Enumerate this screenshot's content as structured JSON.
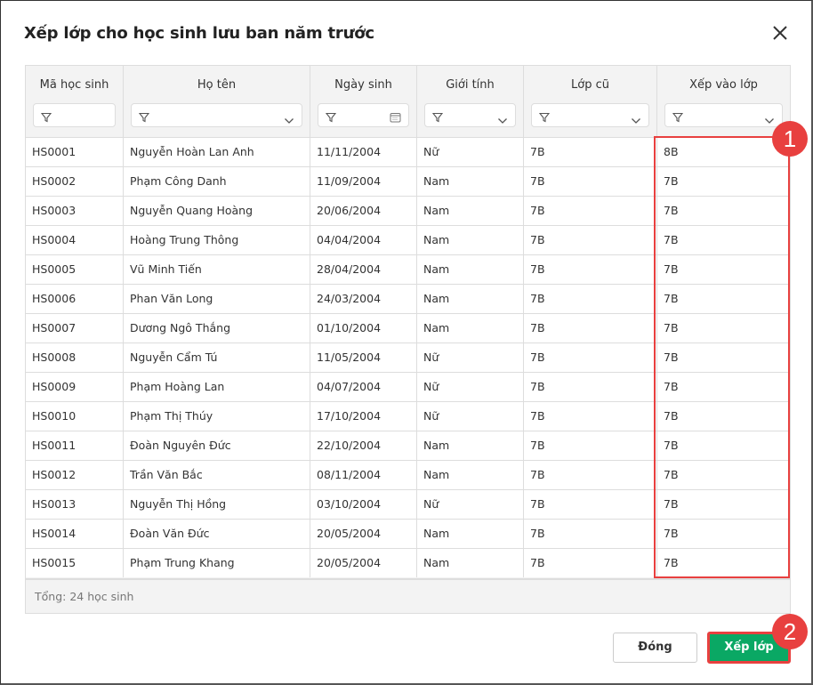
{
  "dialog": {
    "title": "Xếp lớp cho học sinh lưu ban năm trước"
  },
  "columns": [
    {
      "label": "Mã học sinh",
      "filter": "text"
    },
    {
      "label": "Họ tên",
      "filter": "dropdown"
    },
    {
      "label": "Ngày sinh",
      "filter": "date"
    },
    {
      "label": "Giới tính",
      "filter": "dropdown"
    },
    {
      "label": "Lớp cũ",
      "filter": "dropdown"
    },
    {
      "label": "Xếp vào lớp",
      "filter": "dropdown"
    }
  ],
  "rows": [
    [
      "HS0001",
      "Nguyễn Hoàn Lan Anh",
      "11/11/2004",
      "Nữ",
      "7B",
      "8B"
    ],
    [
      "HS0002",
      "Phạm Công Danh",
      "11/09/2004",
      "Nam",
      "7B",
      "7B"
    ],
    [
      "HS0003",
      "Nguyễn Quang Hoàng",
      "20/06/2004",
      "Nam",
      "7B",
      "7B"
    ],
    [
      "HS0004",
      "Hoàng Trung Thông",
      "04/04/2004",
      "Nam",
      "7B",
      "7B"
    ],
    [
      "HS0005",
      "Vũ Minh Tiến",
      "28/04/2004",
      "Nam",
      "7B",
      "7B"
    ],
    [
      "HS0006",
      "Phan Văn Long",
      "24/03/2004",
      "Nam",
      "7B",
      "7B"
    ],
    [
      "HS0007",
      "Dương Ngô Thắng",
      "01/10/2004",
      "Nam",
      "7B",
      "7B"
    ],
    [
      "HS0008",
      "Nguyễn Cẩm Tú",
      "11/05/2004",
      "Nữ",
      "7B",
      "7B"
    ],
    [
      "HS0009",
      "Phạm Hoàng Lan",
      "04/07/2004",
      "Nữ",
      "7B",
      "7B"
    ],
    [
      "HS0010",
      "Phạm Thị Thúy",
      "17/10/2004",
      "Nữ",
      "7B",
      "7B"
    ],
    [
      "HS0011",
      "Đoàn Nguyên Đức",
      "22/10/2004",
      "Nam",
      "7B",
      "7B"
    ],
    [
      "HS0012",
      "Trần Văn Bắc",
      "08/11/2004",
      "Nam",
      "7B",
      "7B"
    ],
    [
      "HS0013",
      "Nguyễn Thị Hồng",
      "03/10/2004",
      "Nữ",
      "7B",
      "7B"
    ],
    [
      "HS0014",
      "Đoàn Văn Đức",
      "20/05/2004",
      "Nam",
      "7B",
      "7B"
    ],
    [
      "HS0015",
      "Phạm Trung Khang",
      "20/05/2004",
      "Nam",
      "7B",
      "7B"
    ]
  ],
  "footer": {
    "total": "Tổng: 24 học sinh"
  },
  "buttons": {
    "close": "Đóng",
    "assign": "Xếp lớp"
  },
  "annotations": {
    "one": "1",
    "two": "2"
  },
  "colors": {
    "accent": "#0aa864",
    "highlight": "#e8403f"
  }
}
